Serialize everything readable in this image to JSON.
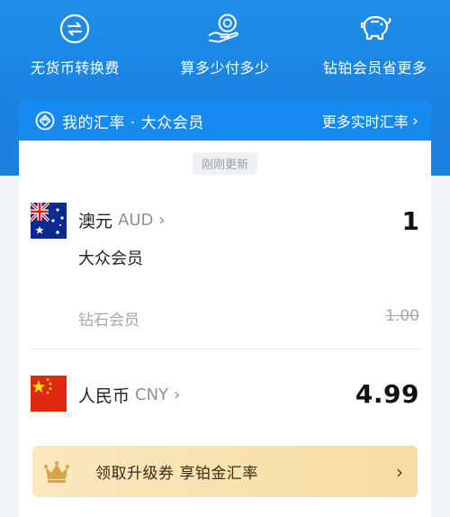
{
  "features": [
    {
      "label": "无货币转换费",
      "icon": "exchange-icon"
    },
    {
      "label": "算多少付多少",
      "icon": "hand-coin-icon"
    },
    {
      "label": "钻铂会员省更多",
      "icon": "piggy-bank-icon"
    }
  ],
  "card": {
    "title": "我的汇率 · 大众会员",
    "more_link": "更多实时汇率",
    "updated": "刚刚更新"
  },
  "source_currency": {
    "name": "澳元",
    "code": "AUD",
    "amount": "1",
    "member_label": "大众会员",
    "diamond_label": "钻石会员",
    "diamond_rate": "1.00"
  },
  "target_currency": {
    "name": "人民币",
    "code": "CNY",
    "amount": "4.99"
  },
  "promo": {
    "text": "领取升级券 享铂金汇率"
  },
  "colors": {
    "header_blue": "#1a82e3",
    "card_header_blue": "#168af0",
    "promo_gold": "#f8e2b0"
  }
}
